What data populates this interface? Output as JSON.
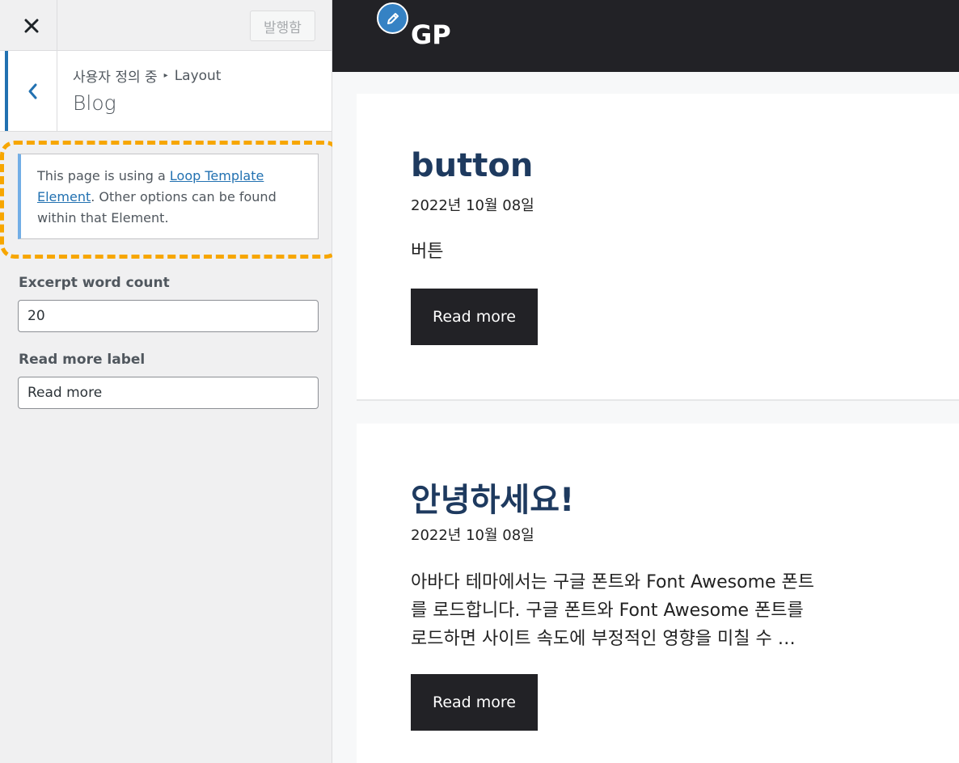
{
  "customizer": {
    "publish_label": "발행함",
    "breadcrumb_parent": "사용자 정의 중",
    "breadcrumb_child": "Layout",
    "section_title": "Blog",
    "notice": {
      "text_before": "This page is using a ",
      "link_text": "Loop Template Element",
      "text_after": ". Other options can be found within that Element."
    },
    "fields": [
      {
        "label": "Excerpt word count",
        "value": "20"
      },
      {
        "label": "Read more label",
        "value": "Read more"
      }
    ]
  },
  "preview": {
    "site_title": "GP",
    "posts": [
      {
        "title": "button",
        "date": "2022년 10월 08일",
        "excerpt": "버튼",
        "read_more": "Read more"
      },
      {
        "title": "안녕하세요!",
        "date": "2022년 10월 08일",
        "excerpt_lines": [
          "아바다 테마에서는 구글 폰트와 Font Awesome 폰트",
          "를 로드합니다. 구글 폰트와 Font Awesome 폰트를",
          "로드하면 사이트 속도에 부정적인 영향을 미칠 수 …"
        ],
        "read_more": "Read more"
      }
    ]
  },
  "colors": {
    "accent_blue": "#2271b1",
    "highlight_orange": "#f7a600",
    "header_dark": "#222226",
    "post_title": "#1e3a5f"
  }
}
